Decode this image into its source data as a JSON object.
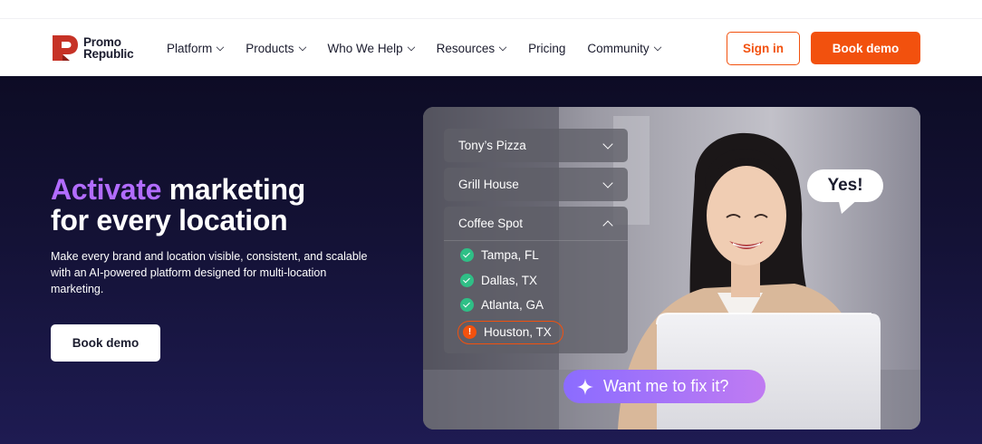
{
  "brand": {
    "name_line1": "Promo",
    "name_line2": "Republic",
    "logo_letter": "P"
  },
  "nav": {
    "items": [
      {
        "label": "Platform",
        "dropdown": true
      },
      {
        "label": "Products",
        "dropdown": true
      },
      {
        "label": "Who We Help",
        "dropdown": true
      },
      {
        "label": "Resources",
        "dropdown": true
      },
      {
        "label": "Pricing",
        "dropdown": false
      },
      {
        "label": "Community",
        "dropdown": true
      }
    ],
    "sign_in_label": "Sign in",
    "book_demo_label": "Book demo"
  },
  "hero": {
    "title_accent": "Activate",
    "title_rest_line1": " marketing",
    "title_line2": "for every location",
    "subtitle": "Make every brand and location visible, consistent, and scalable with an AI-powered platform designed for multi-location marketing.",
    "cta_label": "Book demo"
  },
  "visual": {
    "dropdowns": [
      {
        "label": "Tony’s Pizza",
        "expanded": false
      },
      {
        "label": "Grill House",
        "expanded": false
      },
      {
        "label": "Coffee Spot",
        "expanded": true
      }
    ],
    "locations": [
      {
        "label": "Tampa, FL",
        "status": "ok"
      },
      {
        "label": "Dallas, TX",
        "status": "ok"
      },
      {
        "label": "Atlanta, GA",
        "status": "ok"
      },
      {
        "label": "Houston, TX",
        "status": "warning"
      }
    ],
    "warning_glyph": "!",
    "speech_bubble": "Yes!",
    "assistant_prompt": "Want me to fix it?"
  },
  "colors": {
    "accent_orange": "#f2510e",
    "accent_purple": "#b26cff",
    "hero_bg_dark": "#0d0c25",
    "check_green": "#2fbf86"
  }
}
